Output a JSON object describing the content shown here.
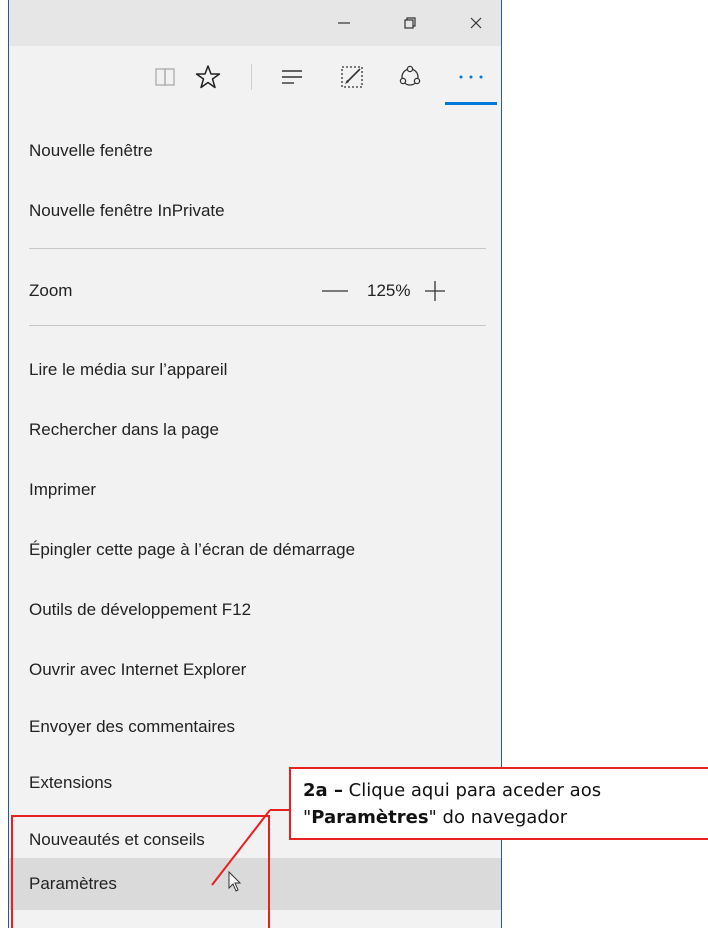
{
  "window": {
    "controls": [
      "minimize-icon",
      "restore-icon",
      "close-icon"
    ]
  },
  "toolbar": {
    "icons": [
      "reading-view-icon",
      "favorite-star-icon",
      "hub-icon",
      "web-note-icon",
      "share-icon",
      "more-actions-icon"
    ]
  },
  "menu": {
    "items": [
      "Nouvelle fenêtre",
      "Nouvelle fenêtre InPrivate",
      "Zoom",
      "Lire le média sur l’appareil",
      "Rechercher dans la page",
      "Imprimer",
      "Épingler cette page à l’écran de démarrage",
      "Outils de développement F12",
      "Ouvrir avec Internet Explorer",
      "Envoyer des commentaires",
      "Extensions",
      "Nouveautés et conseils",
      "Paramètres"
    ],
    "zoom_value": "125%"
  },
  "annotation": {
    "step": "2a –",
    "line1": " Clique aqui para aceder aos",
    "quote_open": "\"",
    "target": "Paramètres",
    "quote_close": "\"",
    "line2_rest": " do navegador",
    "color": "#e82020"
  },
  "colors": {
    "accent": "#0078d7",
    "titlebar": "#e6e6e6",
    "menu_bg": "#f2f2f2",
    "hover": "#dadada"
  }
}
